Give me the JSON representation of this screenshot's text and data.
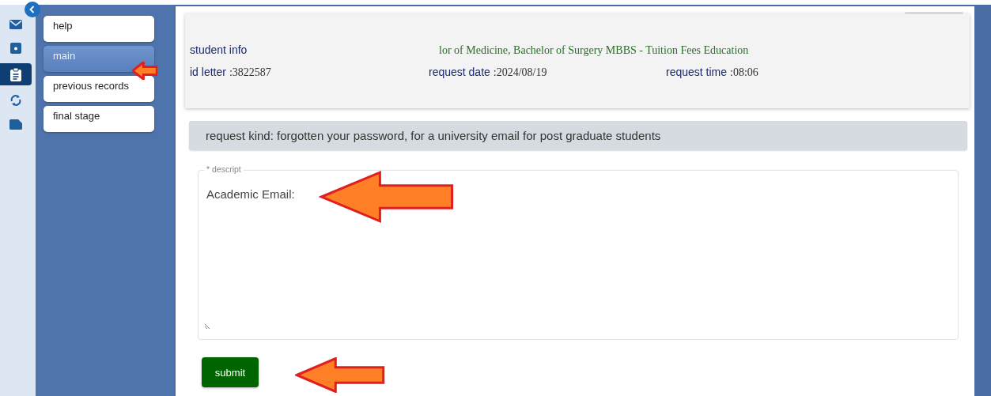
{
  "rail": [
    {
      "kind": "mail",
      "selected": false
    },
    {
      "kind": "inbox",
      "selected": false
    },
    {
      "kind": "clipboard",
      "selected": true
    },
    {
      "kind": "sync",
      "selected": false
    },
    {
      "kind": "file",
      "selected": false
    }
  ],
  "menu": [
    {
      "label": "help",
      "selected": false
    },
    {
      "label": "main",
      "selected": true
    },
    {
      "label": "previous records",
      "selected": false
    },
    {
      "label": "final stage",
      "selected": false
    }
  ],
  "info": {
    "title": "student info",
    "program": "lor of Medicine, Bachelor of Surgery MBBS - Tuition Fees Education",
    "fields": [
      {
        "label": "id letter",
        "value": ":3822587"
      },
      {
        "label": "request date",
        "value": ":2024/08/19"
      },
      {
        "label": "request time",
        "value": ":08:06"
      }
    ]
  },
  "request_kind": "request kind: forgotten your password, for a university email for post graduate students",
  "description": {
    "label": "* descript",
    "value": "Academic Email:"
  },
  "submit": "submit"
}
